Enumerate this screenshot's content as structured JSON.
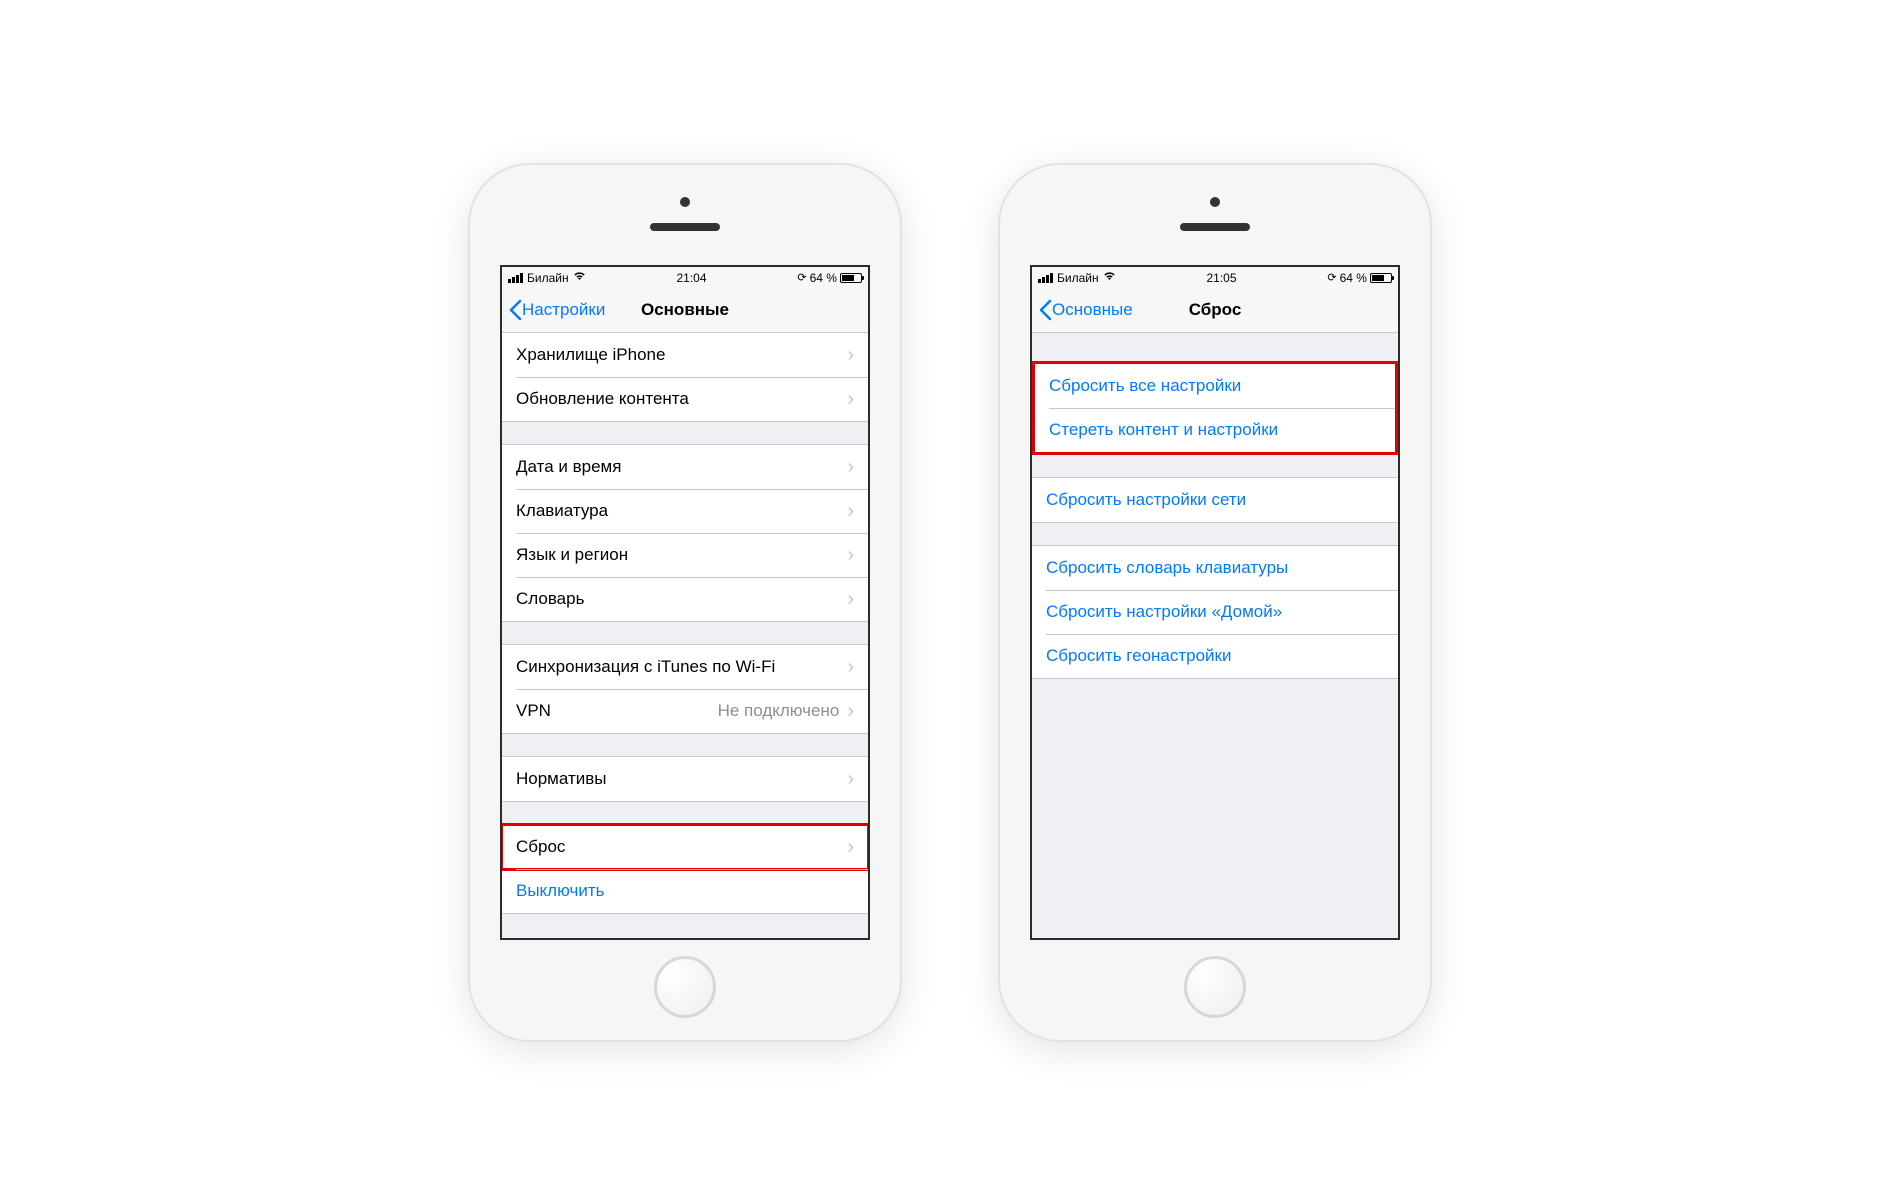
{
  "phone1": {
    "status": {
      "carrier": "Билайн",
      "time": "21:04",
      "battery": "64 %"
    },
    "nav": {
      "back": "Настройки",
      "title": "Основные"
    },
    "g1": [
      {
        "label": "Хранилище iPhone"
      },
      {
        "label": "Обновление контента"
      }
    ],
    "g2": [
      {
        "label": "Дата и время"
      },
      {
        "label": "Клавиатура"
      },
      {
        "label": "Язык и регион"
      },
      {
        "label": "Словарь"
      }
    ],
    "g3": [
      {
        "label": "Синхронизация с iTunes по Wi-Fi"
      },
      {
        "label": "VPN",
        "detail": "Не подключено"
      }
    ],
    "g4": [
      {
        "label": "Нормативы"
      }
    ],
    "g5": [
      {
        "label": "Сброс"
      },
      {
        "label": "Выключить",
        "link": true
      }
    ]
  },
  "phone2": {
    "status": {
      "carrier": "Билайн",
      "time": "21:05",
      "battery": "64 %"
    },
    "nav": {
      "back": "Основные",
      "title": "Сброс"
    },
    "g1": [
      {
        "label": "Сбросить все настройки"
      },
      {
        "label": "Стереть контент и настройки"
      }
    ],
    "g2": [
      {
        "label": "Сбросить настройки сети"
      }
    ],
    "g3": [
      {
        "label": "Сбросить словарь клавиатуры"
      },
      {
        "label": "Сбросить настройки «Домой»"
      },
      {
        "label": "Сбросить геонастройки"
      }
    ]
  },
  "icons": {
    "rotation_lock": "⊕"
  }
}
